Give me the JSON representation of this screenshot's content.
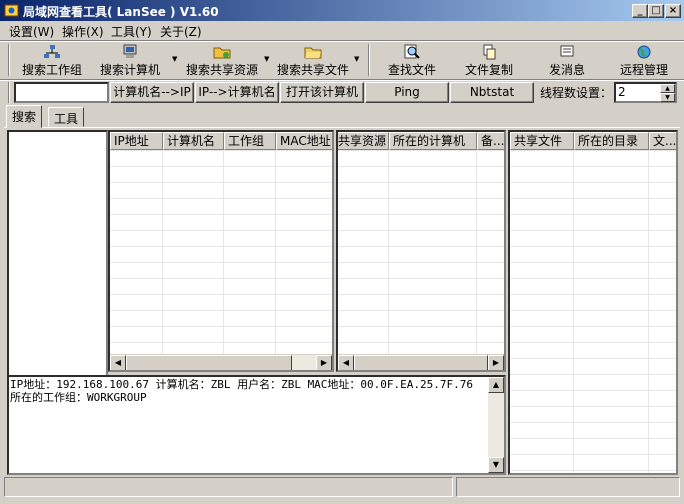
{
  "window": {
    "title": "局域网查看工具( LanSee ) V1.60"
  },
  "window_buttons": {
    "minimize": "_",
    "maximize": "□",
    "close": "×"
  },
  "menu": [
    "设置(W)",
    "操作(X)",
    "工具(Y)",
    "关于(Z)"
  ],
  "toolbar": [
    "搜索工作组",
    "搜索计算机",
    "搜索共享资源",
    "搜索共享文件",
    "查找文件",
    "文件复制",
    "发消息",
    "远程管理"
  ],
  "actions": {
    "input_value": "",
    "name_to_ip": "计算机名-->IP",
    "ip_to_name": "IP-->计算机名",
    "open_computer": "打开该计算机",
    "ping": "Ping",
    "nbtstat": "Nbtstat",
    "threads_label": "线程数设置：",
    "threads_value": "2"
  },
  "tabs": [
    "搜索",
    "工具"
  ],
  "computers_table": {
    "columns": [
      "IP地址",
      "计算机名",
      "工作组",
      "MAC地址"
    ]
  },
  "shares_table": {
    "columns": [
      "共享资源",
      "所在的计算机",
      "备..."
    ]
  },
  "files_table": {
    "columns": [
      "共享文件",
      "所在的目录",
      "文..."
    ]
  },
  "info": "IP地址：192.168.100.67 计算机名：ZBL 用户名：ZBL MAC地址：00.0F.EA.25.7F.76 所在的工作组：WORKGROUP",
  "status": [
    "",
    ""
  ],
  "colors": {
    "titlebar_start": "#0a246a",
    "titlebar_end": "#a6caf0",
    "face": "#d4d0c8"
  }
}
